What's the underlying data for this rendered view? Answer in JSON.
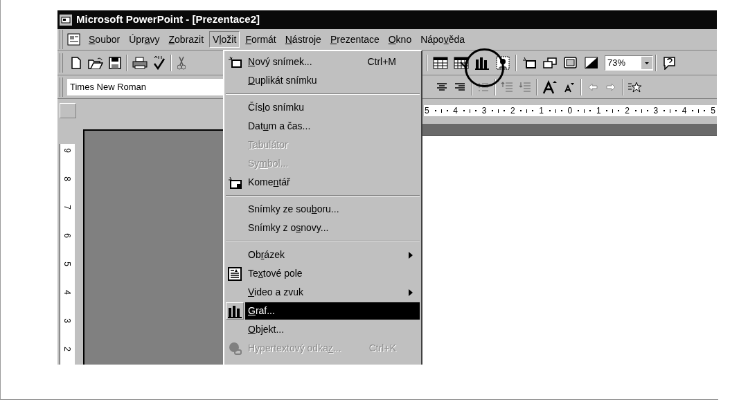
{
  "window": {
    "title": "Microsoft PowerPoint - [Prezentace2]"
  },
  "menubar": [
    {
      "key": "S",
      "post": "oubor",
      "selected": false
    },
    {
      "pre": "Úpr",
      "key": "a",
      "post": "vy",
      "selected": false
    },
    {
      "key": "Z",
      "post": "obrazit",
      "selected": false
    },
    {
      "pre": "V",
      "key": "l",
      "post": "ožit",
      "selected": true
    },
    {
      "key": "F",
      "post": "ormát",
      "selected": false
    },
    {
      "key": "N",
      "post": "ástroje",
      "selected": false
    },
    {
      "key": "P",
      "post": "rezentace",
      "selected": false
    },
    {
      "key": "O",
      "post": "kno",
      "selected": false
    },
    {
      "pre": "Nápo",
      "key": "v",
      "post": "ěda",
      "selected": false
    }
  ],
  "toolbar": {
    "zoom": "73%"
  },
  "formatting": {
    "font": "Times New Roman"
  },
  "ruler": {
    "horizontal": [
      "5",
      "4",
      "3",
      "2",
      "1",
      "0",
      "1",
      "2",
      "3",
      "4",
      "5"
    ],
    "vertical": [
      "9",
      "8",
      "7",
      "6",
      "5",
      "4",
      "3",
      "2"
    ]
  },
  "menu": {
    "items": [
      {
        "kind": "item",
        "key": "N",
        "post": "ový snímek...",
        "shortcut": "Ctrl+M",
        "disabled": false,
        "selected": false
      },
      {
        "kind": "item",
        "key": "D",
        "post": "uplikát snímku",
        "disabled": false,
        "selected": false
      },
      {
        "kind": "separator"
      },
      {
        "kind": "item",
        "pre": "Čís",
        "key": "l",
        "post": "o snímku",
        "disabled": false,
        "selected": false
      },
      {
        "kind": "item",
        "pre": "Dat",
        "key": "u",
        "post": "m a čas...",
        "disabled": false,
        "selected": false
      },
      {
        "kind": "item",
        "key": "T",
        "post": "abulátor",
        "disabled": true,
        "selected": false
      },
      {
        "kind": "item",
        "pre": "Sy",
        "key": "m",
        "post": "bol...",
        "disabled": true,
        "selected": false
      },
      {
        "kind": "item",
        "pre": "Kome",
        "key": "n",
        "post": "tář",
        "disabled": false,
        "selected": false
      },
      {
        "kind": "separator"
      },
      {
        "kind": "item",
        "pre": "Snímky ze sou",
        "key": "b",
        "post": "oru...",
        "disabled": false,
        "selected": false
      },
      {
        "kind": "item",
        "pre": "Snímky z o",
        "key": "s",
        "post": "novy...",
        "disabled": false,
        "selected": false
      },
      {
        "kind": "separator"
      },
      {
        "kind": "submenu",
        "pre": "Ob",
        "key": "r",
        "post": "ázek",
        "disabled": false,
        "selected": false
      },
      {
        "kind": "item",
        "pre": "Te",
        "key": "x",
        "post": "tové pole",
        "disabled": false,
        "selected": false
      },
      {
        "kind": "submenu",
        "key": "V",
        "post": "ideo a zvuk",
        "disabled": false,
        "selected": false
      },
      {
        "kind": "item",
        "key": "G",
        "post": "raf...",
        "disabled": false,
        "selected": true
      },
      {
        "kind": "item",
        "key": "O",
        "post": "bjekt...",
        "disabled": false,
        "selected": false
      },
      {
        "kind": "item",
        "pre": "Hypertextový odka",
        "key": "z",
        "post": "...",
        "shortcut": "Ctrl+K",
        "disabled": true,
        "selected": false
      }
    ]
  }
}
